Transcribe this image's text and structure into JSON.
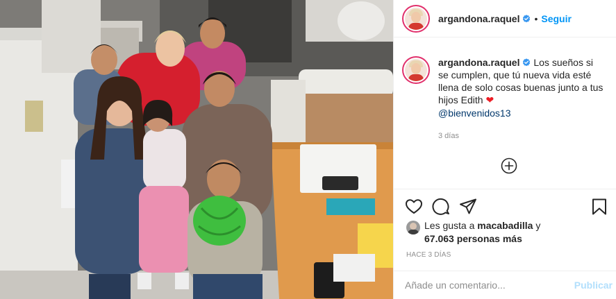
{
  "header": {
    "username": "argandona.raquel",
    "separator": "•",
    "follow_label": "Seguir"
  },
  "caption": {
    "username": "argandona.raquel",
    "text": "Los sueños si se cumplen, que tú nueva vida esté llena de solo cosas buenas junto a tus hijos Edith",
    "emoji": "❤",
    "mention": "@bienvenidos13",
    "time_ago": "3 días"
  },
  "likes": {
    "prefix": "Les gusta a",
    "liker": "macabadilla",
    "connector": "y",
    "count": "67.063 personas más"
  },
  "timestamp": "HACE 3 DÍAS",
  "comment": {
    "placeholder": "Añade un comentario...",
    "publish_label": "Publicar"
  },
  "icons": {
    "verified": "verified-badge-icon",
    "load_more": "plus-circle-icon",
    "like": "heart-outline-icon",
    "comment": "speech-bubble-icon",
    "share": "paper-plane-icon",
    "save": "bookmark-icon"
  },
  "colors": {
    "link_blue": "#0095f6",
    "verified_blue": "#3897f0",
    "publish_disabled": "#b2dffc",
    "secondary_text": "#8e8e8e",
    "heart_red": "#ed1c24"
  }
}
